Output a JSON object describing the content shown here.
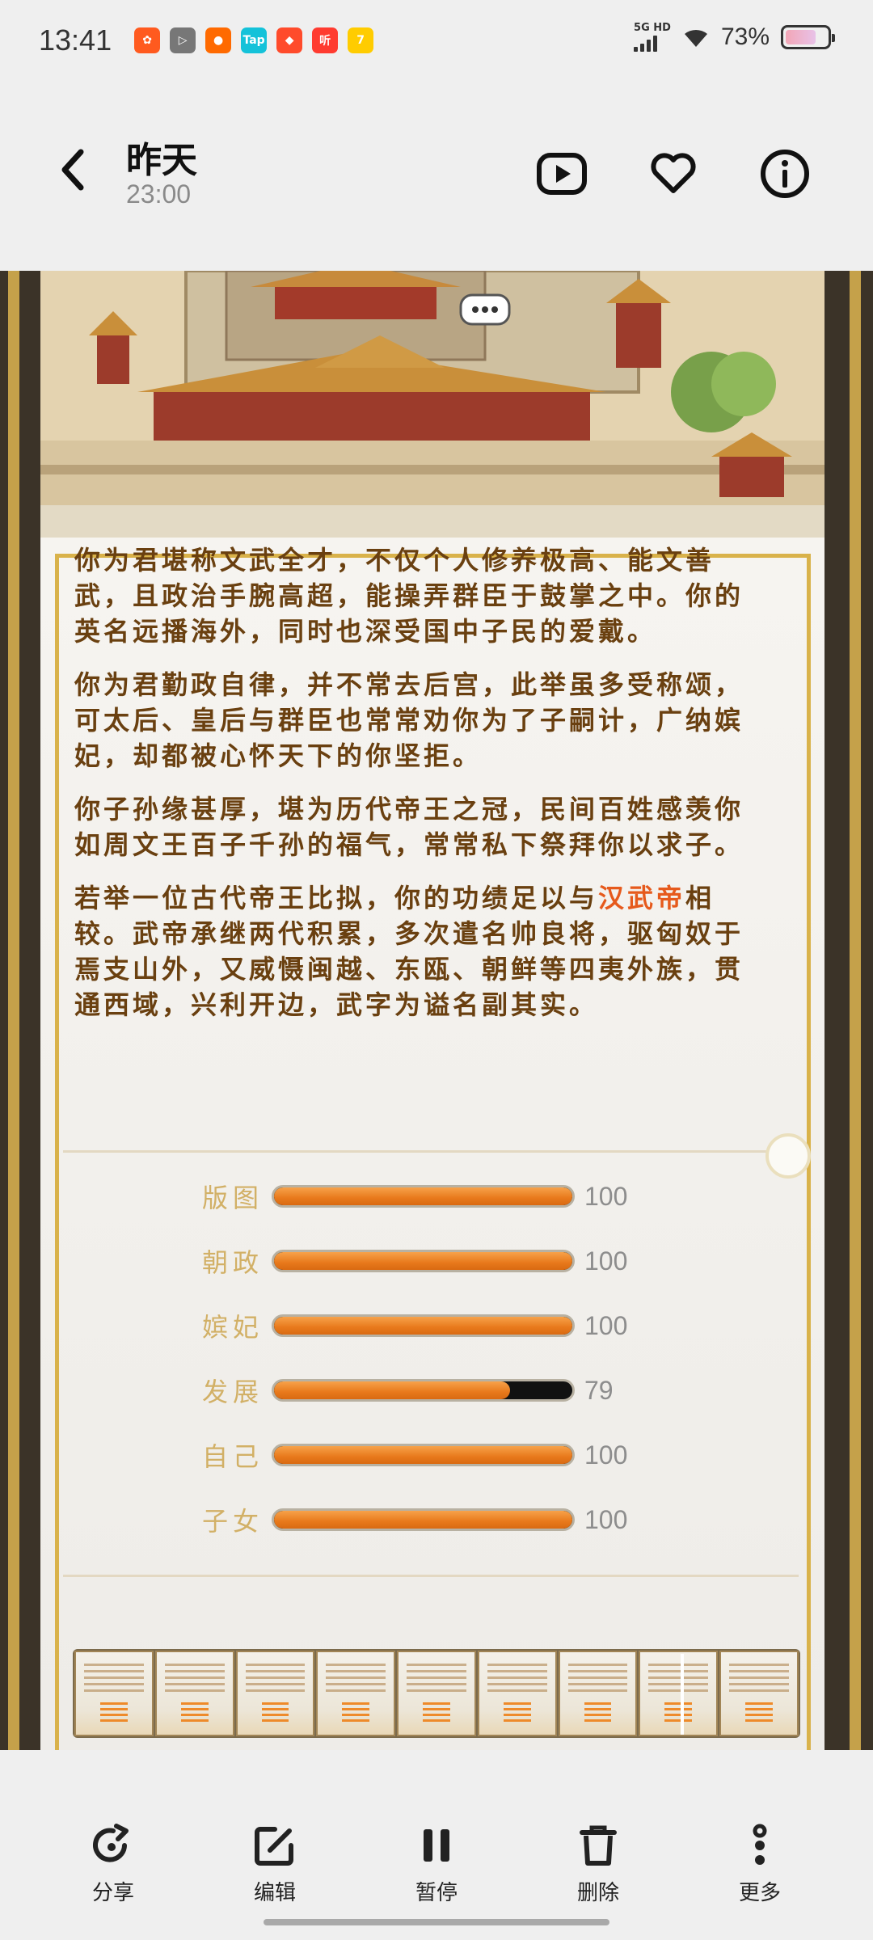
{
  "status_bar": {
    "time": "13:41",
    "network": "5G HD",
    "battery_percent": "73%",
    "battery_level": 0.73,
    "apps": [
      {
        "icon": "kuaishou-icon",
        "color": "#ff5a1f",
        "glyph": "✿"
      },
      {
        "icon": "play-icon",
        "color": "#777777",
        "glyph": "▷"
      },
      {
        "icon": "taobao-icon",
        "color": "#ff6a00",
        "glyph": "●"
      },
      {
        "icon": "taptap-icon",
        "color": "#14c2d9",
        "glyph": "Tap"
      },
      {
        "icon": "game-icon",
        "color": "#ff4b2b",
        "glyph": "◆"
      },
      {
        "icon": "listen-icon",
        "color": "#ff3b30",
        "glyph": "听"
      },
      {
        "icon": "qimao-icon",
        "color": "#ffcc00",
        "glyph": "7"
      }
    ]
  },
  "header": {
    "title": "昨天",
    "time": "23:00"
  },
  "article": {
    "paragraphs": [
      {
        "text": "你为君堪称文武全才，不仅个人修养极高、能文善武，且政治手腕高超，能操弄群臣于鼓掌之中。你的英名远播海外，同时也深受国中子民的爱戴。"
      },
      {
        "text": "你为君勤政自律，并不常去后宫，此举虽多受称颂，可太后、皇后与群臣也常常劝你为了子嗣计，广纳嫔妃，却都被心怀天下的你坚拒。"
      },
      {
        "text": "你子孙缘甚厚，堪为历代帝王之冠，民间百姓感羡你如周文王百子千孙的福气，常常私下祭拜你以求子。"
      }
    ],
    "last_paragraph": {
      "before": "若举一位古代帝王比拟，你的功绩足以与",
      "highlight": "汉武帝",
      "after": "相较。武帝承继两代积累，多次遣名帅良将，驱匈奴于焉支山外，又威慑闽越、东瓯、朝鲜等四夷外族，贯通西域，兴利开边，武字为谥名副其实。"
    }
  },
  "stats": [
    {
      "label": "版图",
      "value": "100",
      "fraction": 1.0
    },
    {
      "label": "朝政",
      "value": "100",
      "fraction": 1.0
    },
    {
      "label": "嫔妃",
      "value": "100",
      "fraction": 1.0
    },
    {
      "label": "发展",
      "value": "79",
      "fraction": 0.79
    },
    {
      "label": "自己",
      "value": "100",
      "fraction": 1.0
    },
    {
      "label": "子女",
      "value": "100",
      "fraction": 1.0
    }
  ],
  "thumbnails_count": 9,
  "toolbar": {
    "share": "分享",
    "edit": "编辑",
    "pause": "暂停",
    "delete": "删除",
    "more": "更多"
  },
  "colors": {
    "accent_orange": "#e8791b",
    "gold": "#d9b24a",
    "text_brown": "#6a4010",
    "highlight": "#e65a1c"
  }
}
